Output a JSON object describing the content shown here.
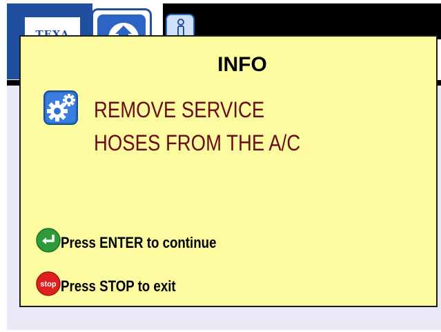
{
  "brand": {
    "logo_text": "TEXA"
  },
  "toolbar": {
    "home_icon": "home-icon",
    "info_icon": "info-icon"
  },
  "dialog": {
    "title": "INFO",
    "icon": "gears-icon",
    "message_lines": [
      "REMOVE SERVICE",
      "HOSES FROM THE A/C"
    ],
    "enter_hint": "Press ENTER to continue",
    "stop_hint": "Press STOP to exit",
    "stop_icon_text": "stop"
  },
  "colors": {
    "dialog_background": "#fdfba0",
    "message_text": "#6b0b12",
    "brand_blue": "#1f4f9e",
    "enter_green": "#2e9b3a",
    "stop_red": "#e0201f"
  }
}
